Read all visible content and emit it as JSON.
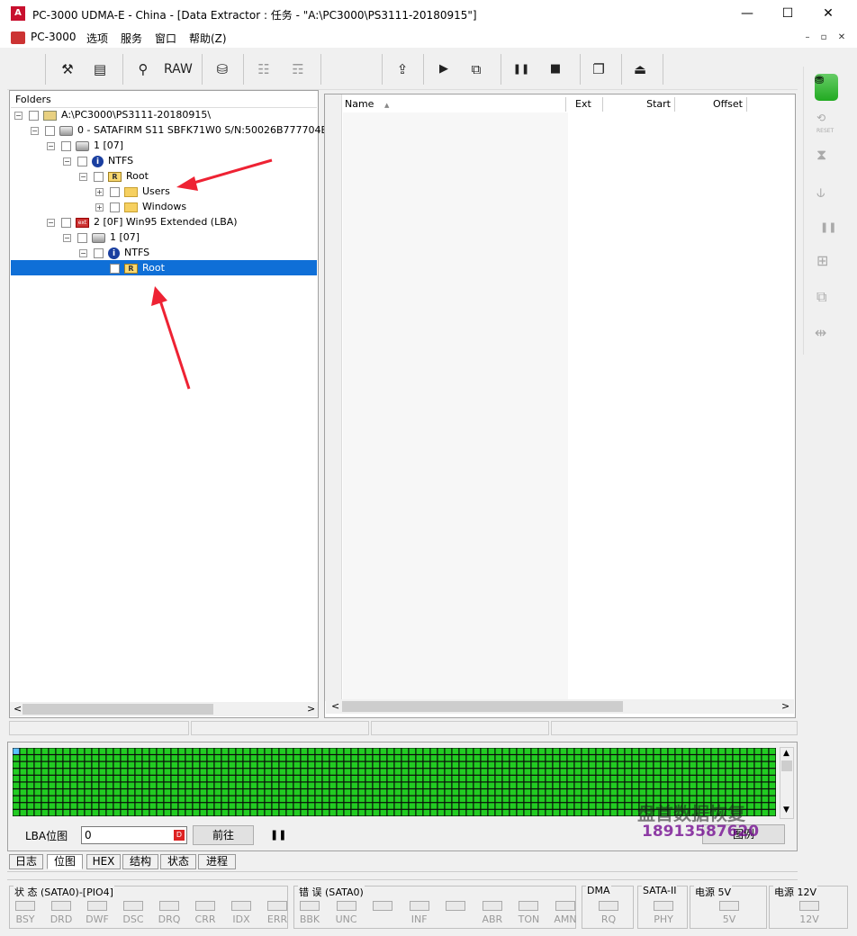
{
  "window": {
    "app_icon": "app-logo-icon",
    "title": "PC-3000 UDMA-E - China - [Data Extractor : 任务 - \"A:\\PC3000\\PS3111-20180915\"]",
    "min": "—",
    "max": "☐",
    "close": "✕"
  },
  "menu": {
    "items": [
      "PC-3000",
      "选项",
      "服务",
      "窗口",
      "帮助(Z)"
    ],
    "mdi": [
      "–",
      "▫",
      "✕"
    ]
  },
  "toolbar": {
    "tools_icon": "⚒",
    "scroll_icon": "▤",
    "search_icon": "⚲",
    "raw_label": "RAW",
    "disk_icon": "⛁",
    "tree1_icon": "☷",
    "tree2_icon": "☶",
    "export_icon": "⇪",
    "play_icon": "▶",
    "flow_icon": "⧉",
    "pause_icon": "❚❚",
    "stop_icon": "■",
    "copy_icon": "❐",
    "exit_icon": "⏏"
  },
  "folders": {
    "header": "Folders",
    "tree": [
      {
        "level": 0,
        "exp": "−",
        "icon": "pkg",
        "icon_label": "",
        "label": "A:\\PC3000\\PS3111-20180915\\"
      },
      {
        "level": 1,
        "exp": "−",
        "icon": "drive",
        "icon_label": "",
        "label": "0 - SATAFIRM   S11 SBFK71W0 S/N:50026B777704E"
      },
      {
        "level": 2,
        "exp": "−",
        "icon": "drive",
        "icon_label": "",
        "label": "1 [07]"
      },
      {
        "level": 3,
        "exp": "−",
        "icon": "info",
        "icon_label": "i",
        "label": "NTFS"
      },
      {
        "level": 4,
        "exp": "−",
        "icon": "root",
        "icon_label": "R",
        "label": "Root"
      },
      {
        "level": 5,
        "exp": "+",
        "icon": "folder",
        "icon_label": "",
        "label": "Users"
      },
      {
        "level": 5,
        "exp": "+",
        "icon": "folder",
        "icon_label": "",
        "label": "Windows"
      },
      {
        "level": 2,
        "exp": "−",
        "icon": "ext",
        "icon_label": "ext",
        "label": "2 [0F] Win95 Extended  (LBA)"
      },
      {
        "level": 3,
        "exp": "−",
        "icon": "drive",
        "icon_label": "",
        "label": "1 [07]"
      },
      {
        "level": 4,
        "exp": "−",
        "icon": "info",
        "icon_label": "i",
        "label": "NTFS"
      },
      {
        "level": 5,
        "exp": "",
        "icon": "root",
        "icon_label": "R",
        "label": "Root",
        "selected": true
      }
    ]
  },
  "files": {
    "columns": {
      "name": "Name",
      "sort": "▲",
      "ext": "Ext",
      "start": "Start",
      "offset": "Offset"
    }
  },
  "scroll": {
    "left": "<",
    "right": ">",
    "up": "▲",
    "down": "▼"
  },
  "bitmap": {
    "lba_label": "LBA位图",
    "lba_value": "0",
    "goto_label": "前往",
    "pause_icon": "❚❚",
    "map_button": "图例"
  },
  "tabs": [
    "日志",
    "位图",
    "HEX",
    "结构",
    "状态",
    "进程"
  ],
  "active_tab": 1,
  "status": {
    "groups": [
      {
        "title": "状 态 (SATA0)-[PIO4]",
        "leds": [
          "BSY",
          "DRD",
          "DWF",
          "DSC",
          "DRQ",
          "CRR",
          "IDX",
          "ERR"
        ]
      },
      {
        "title": "错 误 (SATA0)",
        "leds": [
          "BBK",
          "UNC",
          "",
          "INF",
          "",
          "ABR",
          "TON",
          "AMN"
        ]
      },
      {
        "title": "DMA",
        "leds": [
          "RQ"
        ]
      },
      {
        "title": "SATA-II",
        "leds": [
          "PHY"
        ]
      },
      {
        "title": "电源 5V",
        "leds": [
          "5V"
        ]
      },
      {
        "title": "电源 12V",
        "leds": [
          "12V"
        ]
      }
    ]
  },
  "right_toolbar": {
    "db_icon": "⛃",
    "reset_icon": "⟲",
    "mirror_icon": "⧗",
    "tree_icon": "⫝",
    "pause_icon": "❚❚",
    "map_icon": "⊞",
    "copy_icon": "⧉",
    "slider_icon": "⇹",
    "reset_label": "RESET"
  },
  "watermark": {
    "line1": "盘首数据恢复",
    "line2": "18913587620"
  },
  "colors": {
    "selection": "#0f6fd7",
    "bitmap_cell": "#22cc22",
    "bitmap_grid": "#0a0a0a"
  }
}
